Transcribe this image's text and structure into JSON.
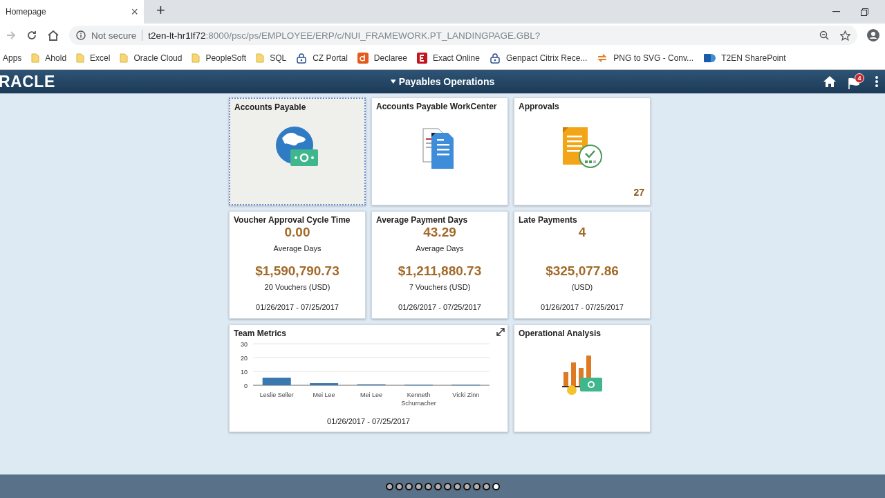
{
  "browser": {
    "tab": {
      "title": "Homepage",
      "close": "×"
    },
    "new_tab": "+",
    "address": {
      "security": "Not secure",
      "host": "t2en-lt-hr1lf72",
      "path": ":8000/psc/ps/EMPLOYEE/ERP/c/NUI_FRAMEWORK.PT_LANDINGPAGE.GBL?"
    },
    "bookmarks": [
      {
        "kind": "apps",
        "label": "Apps"
      },
      {
        "kind": "folder",
        "label": "Ahold"
      },
      {
        "kind": "folder",
        "label": "Excel"
      },
      {
        "kind": "folder",
        "label": "Oracle Cloud"
      },
      {
        "kind": "folder",
        "label": "PeopleSoft"
      },
      {
        "kind": "folder",
        "label": "SQL"
      },
      {
        "kind": "lock",
        "label": "CZ Portal"
      },
      {
        "kind": "d",
        "label": "Declaree"
      },
      {
        "kind": "e",
        "label": "Exact Online"
      },
      {
        "kind": "lock",
        "label": "Genpact Citrix Rece..."
      },
      {
        "kind": "swap",
        "label": "PNG to SVG - Conv..."
      },
      {
        "kind": "sharepoint",
        "label": "T2EN SharePoint"
      }
    ]
  },
  "header": {
    "logo": "RACLE",
    "title": "Payables Operations",
    "notification_count": "4"
  },
  "tiles": [
    {
      "kind": "globe",
      "title": "Accounts Payable",
      "selected": true
    },
    {
      "kind": "documents",
      "title": "Accounts Payable WorkCenter",
      "selected": false
    },
    {
      "kind": "approval",
      "title": "Approvals",
      "count": "27",
      "selected": false
    },
    {
      "kind": "kpi",
      "title": "Voucher Approval Cycle Time",
      "value": "0.00",
      "value_label": "Average Days",
      "amount": "$1,590,790.73",
      "amount_label": "20 Vouchers (USD)",
      "dates": "01/26/2017  - 07/25/2017",
      "selected": false
    },
    {
      "kind": "kpi",
      "title": "Average Payment Days",
      "value": "43.29",
      "value_label": "Average Days",
      "amount": "$1,211,880.73",
      "amount_label": "7 Vouchers (USD)",
      "dates": "01/26/2017  - 07/25/2017",
      "selected": false
    },
    {
      "kind": "kpi",
      "title": "Late Payments",
      "value": "4",
      "amount": "$325,077.86",
      "amount_label": "(USD)",
      "dates": "01/26/2017  - 07/25/2017",
      "selected": false
    },
    {
      "kind": "chart",
      "title": "Team Metrics",
      "dates": "01/26/2017  - 07/25/2017",
      "selected": false,
      "chart_data": {
        "type": "bar",
        "categories": [
          "Leslie Seller",
          "Mei Lee",
          "Mei Lee",
          "Kenneth Schumacher",
          "Vicki Zinn"
        ],
        "series": [
          {
            "color": "#3a78b0",
            "values": [
              5.5,
              1.5,
              0.7,
              0.4,
              0.4
            ]
          }
        ],
        "ylim": [
          0,
          30
        ],
        "yticks": [
          0,
          10,
          20,
          30
        ]
      }
    },
    {
      "kind": "analysis",
      "title": "Operational Analysis",
      "selected": false
    }
  ],
  "pager": [
    {
      "selected": false
    },
    {
      "selected": false
    },
    {
      "selected": false
    },
    {
      "selected": false
    },
    {
      "selected": false
    },
    {
      "selected": false
    },
    {
      "selected": false
    },
    {
      "selected": false
    },
    {
      "selected": false
    },
    {
      "selected": false
    },
    {
      "selected": false
    },
    {
      "selected": true
    }
  ]
}
